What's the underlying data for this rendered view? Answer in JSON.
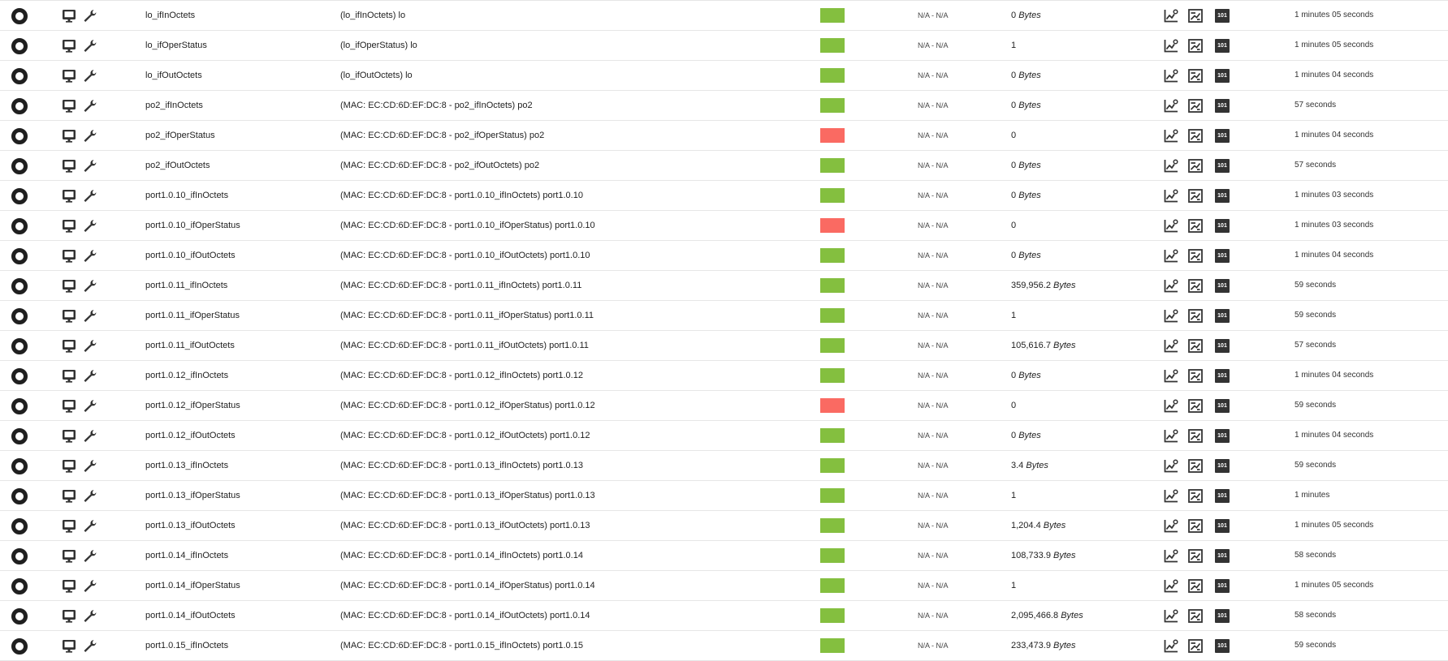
{
  "colors": {
    "ok": "#84bf3f",
    "critical": "#fa6a62",
    "icon": "#333333"
  },
  "icons": {
    "status": "status-ring-icon",
    "view": "monitor-icon",
    "edit": "wrench-icon",
    "graph": "line-graph-icon",
    "graph_alt": "histogram-graph-icon",
    "raw": "raw-data-101-icon"
  },
  "raw_badge_label": "101",
  "rows": [
    {
      "name": "lo_ifInOctets",
      "description": "(lo_ifInOctets) lo",
      "status": "ok",
      "range": "N/A - N/A",
      "value": "0",
      "unit": "Bytes",
      "updated": "1 minutes 05 seconds"
    },
    {
      "name": "lo_ifOperStatus",
      "description": "(lo_ifOperStatus) lo",
      "status": "ok",
      "range": "N/A - N/A",
      "value": "1",
      "unit": "",
      "updated": "1 minutes 05 seconds"
    },
    {
      "name": "lo_ifOutOctets",
      "description": "(lo_ifOutOctets) lo",
      "status": "ok",
      "range": "N/A - N/A",
      "value": "0",
      "unit": "Bytes",
      "updated": "1 minutes 04 seconds"
    },
    {
      "name": "po2_ifInOctets",
      "description": "(MAC: EC:CD:6D:EF:DC:8 - po2_ifInOctets) po2",
      "status": "ok",
      "range": "N/A - N/A",
      "value": "0",
      "unit": "Bytes",
      "updated": "57 seconds"
    },
    {
      "name": "po2_ifOperStatus",
      "description": "(MAC: EC:CD:6D:EF:DC:8 - po2_ifOperStatus) po2",
      "status": "critical",
      "range": "N/A - N/A",
      "value": "0",
      "unit": "",
      "updated": "1 minutes 04 seconds"
    },
    {
      "name": "po2_ifOutOctets",
      "description": "(MAC: EC:CD:6D:EF:DC:8 - po2_ifOutOctets) po2",
      "status": "ok",
      "range": "N/A - N/A",
      "value": "0",
      "unit": "Bytes",
      "updated": "57 seconds"
    },
    {
      "name": "port1.0.10_ifInOctets",
      "description": "(MAC: EC:CD:6D:EF:DC:8 - port1.0.10_ifInOctets) port1.0.10",
      "status": "ok",
      "range": "N/A - N/A",
      "value": "0",
      "unit": "Bytes",
      "updated": "1 minutes 03 seconds"
    },
    {
      "name": "port1.0.10_ifOperStatus",
      "description": "(MAC: EC:CD:6D:EF:DC:8 - port1.0.10_ifOperStatus) port1.0.10",
      "status": "critical",
      "range": "N/A - N/A",
      "value": "0",
      "unit": "",
      "updated": "1 minutes 03 seconds"
    },
    {
      "name": "port1.0.10_ifOutOctets",
      "description": "(MAC: EC:CD:6D:EF:DC:8 - port1.0.10_ifOutOctets) port1.0.10",
      "status": "ok",
      "range": "N/A - N/A",
      "value": "0",
      "unit": "Bytes",
      "updated": "1 minutes 04 seconds"
    },
    {
      "name": "port1.0.11_ifInOctets",
      "description": "(MAC: EC:CD:6D:EF:DC:8 - port1.0.11_ifInOctets) port1.0.11",
      "status": "ok",
      "range": "N/A - N/A",
      "value": "359,956.2",
      "unit": "Bytes",
      "updated": "59 seconds"
    },
    {
      "name": "port1.0.11_ifOperStatus",
      "description": "(MAC: EC:CD:6D:EF:DC:8 - port1.0.11_ifOperStatus) port1.0.11",
      "status": "ok",
      "range": "N/A - N/A",
      "value": "1",
      "unit": "",
      "updated": "59 seconds"
    },
    {
      "name": "port1.0.11_ifOutOctets",
      "description": "(MAC: EC:CD:6D:EF:DC:8 - port1.0.11_ifOutOctets) port1.0.11",
      "status": "ok",
      "range": "N/A - N/A",
      "value": "105,616.7",
      "unit": "Bytes",
      "updated": "57 seconds"
    },
    {
      "name": "port1.0.12_ifInOctets",
      "description": "(MAC: EC:CD:6D:EF:DC:8 - port1.0.12_ifInOctets) port1.0.12",
      "status": "ok",
      "range": "N/A - N/A",
      "value": "0",
      "unit": "Bytes",
      "updated": "1 minutes 04 seconds"
    },
    {
      "name": "port1.0.12_ifOperStatus",
      "description": "(MAC: EC:CD:6D:EF:DC:8 - port1.0.12_ifOperStatus) port1.0.12",
      "status": "critical",
      "range": "N/A - N/A",
      "value": "0",
      "unit": "",
      "updated": "59 seconds"
    },
    {
      "name": "port1.0.12_ifOutOctets",
      "description": "(MAC: EC:CD:6D:EF:DC:8 - port1.0.12_ifOutOctets) port1.0.12",
      "status": "ok",
      "range": "N/A - N/A",
      "value": "0",
      "unit": "Bytes",
      "updated": "1 minutes 04 seconds"
    },
    {
      "name": "port1.0.13_ifInOctets",
      "description": "(MAC: EC:CD:6D:EF:DC:8 - port1.0.13_ifInOctets) port1.0.13",
      "status": "ok",
      "range": "N/A - N/A",
      "value": "3.4",
      "unit": "Bytes",
      "updated": "59 seconds"
    },
    {
      "name": "port1.0.13_ifOperStatus",
      "description": "(MAC: EC:CD:6D:EF:DC:8 - port1.0.13_ifOperStatus) port1.0.13",
      "status": "ok",
      "range": "N/A - N/A",
      "value": "1",
      "unit": "",
      "updated": "1 minutes"
    },
    {
      "name": "port1.0.13_ifOutOctets",
      "description": "(MAC: EC:CD:6D:EF:DC:8 - port1.0.13_ifOutOctets) port1.0.13",
      "status": "ok",
      "range": "N/A - N/A",
      "value": "1,204.4",
      "unit": "Bytes",
      "updated": "1 minutes 05 seconds"
    },
    {
      "name": "port1.0.14_ifInOctets",
      "description": "(MAC: EC:CD:6D:EF:DC:8 - port1.0.14_ifInOctets) port1.0.14",
      "status": "ok",
      "range": "N/A - N/A",
      "value": "108,733.9",
      "unit": "Bytes",
      "updated": "58 seconds"
    },
    {
      "name": "port1.0.14_ifOperStatus",
      "description": "(MAC: EC:CD:6D:EF:DC:8 - port1.0.14_ifOperStatus) port1.0.14",
      "status": "ok",
      "range": "N/A - N/A",
      "value": "1",
      "unit": "",
      "updated": "1 minutes 05 seconds"
    },
    {
      "name": "port1.0.14_ifOutOctets",
      "description": "(MAC: EC:CD:6D:EF:DC:8 - port1.0.14_ifOutOctets) port1.0.14",
      "status": "ok",
      "range": "N/A - N/A",
      "value": "2,095,466.8",
      "unit": "Bytes",
      "updated": "58 seconds"
    },
    {
      "name": "port1.0.15_ifInOctets",
      "description": "(MAC: EC:CD:6D:EF:DC:8 - port1.0.15_ifInOctets) port1.0.15",
      "status": "ok",
      "range": "N/A - N/A",
      "value": "233,473.9",
      "unit": "Bytes",
      "updated": "59 seconds"
    }
  ]
}
